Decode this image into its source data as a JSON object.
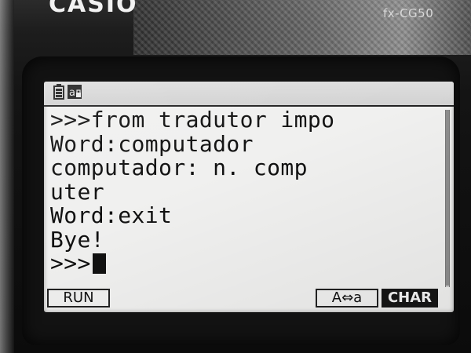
{
  "device": {
    "brand": "CASIO",
    "model": "fx-CG50"
  },
  "status_bar": {
    "icons": [
      "battery-icon",
      "alpha-lock-icon"
    ]
  },
  "terminal": {
    "lines": [
      ">>>from tradutor impo",
      "Word:computador",
      "computador: n. comp",
      "uter",
      "Word:exit",
      "Bye!",
      ">>>"
    ]
  },
  "function_keys": {
    "f1": "RUN",
    "f5": "A⇔a",
    "f6": "CHAR"
  },
  "colors": {
    "screen": "#f0f0ef",
    "text": "#111111",
    "body": "#141414"
  }
}
